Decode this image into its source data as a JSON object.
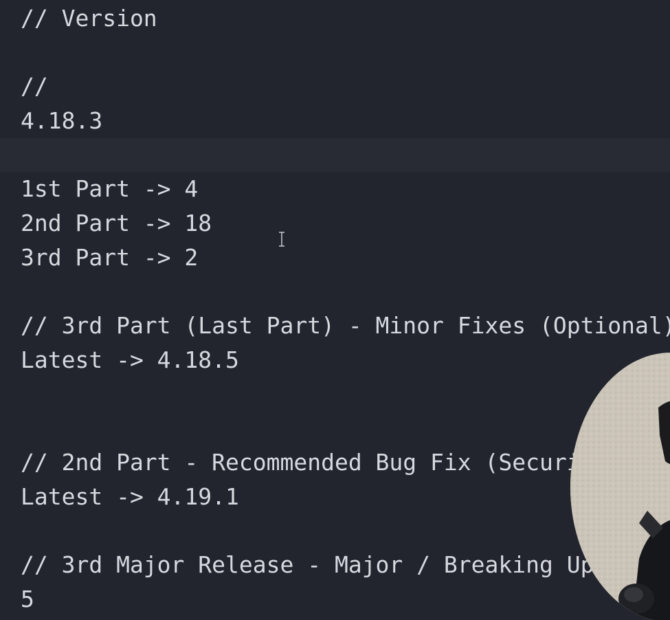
{
  "editor": {
    "lines": [
      "// Version",
      "",
      "//",
      "4.18.3",
      "",
      "1st Part -> 4",
      "2nd Part -> 18",
      "3rd Part -> 2",
      "",
      "// 3rd Part (Last Part) - Minor Fixes (Optional)",
      "Latest -> 4.18.5",
      "",
      "",
      "// 2nd Part - Recommended Bug Fix (Security",
      "Latest -> 4.19.1",
      "",
      "// 3rd Major Release - Major / Breaking Up",
      "5"
    ],
    "current_line": 5
  },
  "icons": {
    "text_cursor": "i-beam-cursor-icon"
  }
}
